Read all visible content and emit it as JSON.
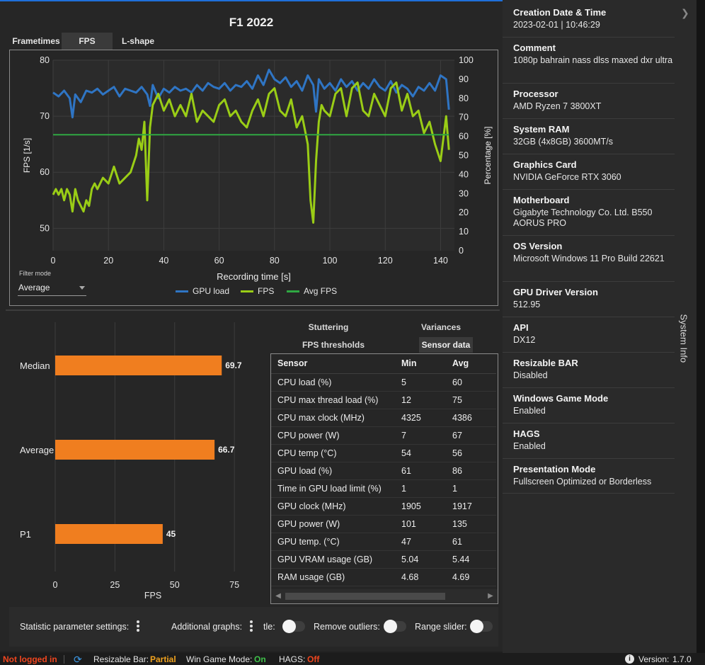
{
  "title": "F1 2022",
  "tabs": [
    "Frametimes",
    "FPS",
    "L-shape"
  ],
  "active_tab": "FPS",
  "filter": {
    "label": "Filter mode",
    "value": "Average"
  },
  "legend": [
    {
      "label": "GPU load",
      "color": "#2f75c4"
    },
    {
      "label": "FPS",
      "color": "#9acd16"
    },
    {
      "label": "Avg FPS",
      "color": "#2fa842"
    }
  ],
  "chart_data": [
    {
      "type": "line",
      "xlabel": "Recording time [s]",
      "ylabel": "FPS [1/s]",
      "y2label": "Percentage [%]",
      "xlim": [
        0,
        145
      ],
      "ylim": [
        46,
        80
      ],
      "y2lim": [
        0,
        100
      ],
      "xticks": [
        0,
        20,
        40,
        60,
        80,
        100,
        120,
        140
      ],
      "yticks": [
        50,
        60,
        70,
        80
      ],
      "y2ticks": [
        0,
        10,
        20,
        30,
        40,
        50,
        60,
        70,
        80,
        90,
        100
      ],
      "grid": true,
      "legend_position": "bottom",
      "series": [
        {
          "name": "GPU load",
          "axis": "right",
          "color": "#2f75c4",
          "x": [
            0,
            2,
            4,
            6,
            7,
            8,
            10,
            12,
            14,
            16,
            18,
            20,
            22,
            24,
            26,
            28,
            30,
            32,
            34,
            35,
            36,
            38,
            40,
            42,
            44,
            46,
            48,
            50,
            52,
            54,
            56,
            58,
            60,
            62,
            64,
            66,
            68,
            70,
            72,
            74,
            76,
            78,
            80,
            82,
            84,
            86,
            88,
            90,
            92,
            94,
            95,
            96,
            98,
            100,
            102,
            104,
            106,
            108,
            110,
            112,
            114,
            116,
            118,
            120,
            122,
            124,
            126,
            128,
            130,
            132,
            134,
            136,
            138,
            140,
            142,
            143
          ],
          "y": [
            83,
            81,
            84,
            80,
            70,
            82,
            78,
            84,
            83,
            85,
            82,
            84,
            86,
            81,
            85,
            84,
            83,
            86,
            82,
            76,
            87,
            80,
            85,
            83,
            86,
            84,
            85,
            83,
            87,
            84,
            88,
            86,
            85,
            88,
            84,
            87,
            86,
            89,
            85,
            92,
            87,
            95,
            90,
            88,
            91,
            86,
            89,
            84,
            92,
            87,
            73,
            90,
            85,
            88,
            84,
            90,
            86,
            89,
            84,
            88,
            85,
            90,
            86,
            84,
            89,
            83,
            87,
            85,
            81,
            86,
            84,
            88,
            84,
            92,
            90,
            74
          ]
        },
        {
          "name": "FPS",
          "axis": "left",
          "color": "#9acd16",
          "x": [
            0,
            1,
            2,
            3,
            4,
            5,
            6,
            7,
            8,
            9,
            10,
            11,
            12,
            13,
            14,
            15,
            16,
            18,
            20,
            22,
            24,
            26,
            28,
            30,
            31,
            32,
            33,
            34,
            35,
            36,
            38,
            40,
            42,
            44,
            46,
            48,
            50,
            52,
            54,
            56,
            58,
            60,
            62,
            64,
            66,
            68,
            70,
            72,
            74,
            76,
            78,
            80,
            82,
            84,
            86,
            88,
            90,
            92,
            93,
            94,
            95,
            96,
            97,
            98,
            100,
            102,
            104,
            106,
            108,
            110,
            112,
            114,
            116,
            118,
            120,
            122,
            124,
            126,
            128,
            130,
            132,
            134,
            136,
            138,
            140,
            142,
            143
          ],
          "y": [
            56,
            57,
            56,
            57,
            55,
            57,
            56,
            53,
            57,
            55,
            54,
            53,
            55,
            54,
            57,
            58,
            57,
            59,
            58,
            61,
            58,
            59,
            60,
            63,
            66,
            64,
            69,
            55,
            68,
            72,
            74,
            71,
            73,
            70,
            72,
            70,
            74,
            69,
            71,
            70,
            69,
            72,
            73,
            70,
            71,
            69,
            68,
            71,
            73,
            70,
            74,
            75,
            71,
            70,
            73,
            68,
            70,
            65,
            55,
            51,
            62,
            69,
            72,
            71,
            70,
            74,
            75,
            70,
            75,
            76,
            71,
            70,
            74,
            72,
            70,
            75,
            76,
            71,
            74,
            70,
            71,
            67,
            69,
            65,
            62,
            70,
            64
          ]
        },
        {
          "name": "Avg FPS",
          "axis": "left",
          "color": "#2fa842",
          "x": [
            0,
            143
          ],
          "y": [
            66.7,
            66.7
          ]
        }
      ]
    },
    {
      "type": "bar",
      "orientation": "horizontal",
      "xlabel": "FPS",
      "categories": [
        "Median",
        "Average",
        "P1"
      ],
      "values": [
        69.7,
        66.7,
        45
      ],
      "xlim": [
        0,
        80
      ],
      "xticks": [
        0,
        25,
        50,
        75
      ],
      "color": "#f07e1f",
      "grid": true
    }
  ],
  "sensor_tabs": [
    {
      "label": "Stuttering"
    },
    {
      "label": "Variances"
    },
    {
      "label": "FPS thresholds"
    },
    {
      "label": "Sensor data"
    }
  ],
  "sensor_table": {
    "columns": [
      "Sensor",
      "Min",
      "Avg"
    ],
    "rows": [
      [
        "CPU load (%)",
        "5",
        "60"
      ],
      [
        "CPU max thread load (%)",
        "12",
        "75"
      ],
      [
        "CPU max clock (MHz)",
        "4325",
        "4386"
      ],
      [
        "CPU power (W)",
        "7",
        "67"
      ],
      [
        "CPU temp (°C)",
        "54",
        "56"
      ],
      [
        "GPU load (%)",
        "61",
        "86"
      ],
      [
        "Time in GPU load limit (%)",
        "1",
        "1"
      ],
      [
        "GPU clock (MHz)",
        "1905",
        "1917"
      ],
      [
        "GPU power (W)",
        "101",
        "135"
      ],
      [
        "GPU temp. (°C)",
        "47",
        "61"
      ],
      [
        "GPU VRAM usage (GB)",
        "5.04",
        "5.44"
      ],
      [
        "RAM usage (GB)",
        "4.68",
        "4.69"
      ]
    ]
  },
  "settings": {
    "statistic_label": "Statistic parameter settings:",
    "additional_label": "Additional graphs:",
    "cut_label": "tle:",
    "outliers_label": "Remove outliers:",
    "range_label": "Range slider:"
  },
  "system_info": {
    "panel_label": "System Info",
    "items": [
      {
        "key": "Creation Date & Time",
        "value": "2023-02-01  |  10:46:29"
      },
      {
        "key": "Comment",
        "value": "1080p bahrain nass dlss maxed dxr ultra"
      },
      {
        "key": "Processor",
        "value": "AMD Ryzen 7 3800XT"
      },
      {
        "key": "System RAM",
        "value": "32GB (4x8GB) 3600MT/s"
      },
      {
        "key": "Graphics Card",
        "value": "NVIDIA GeForce RTX 3060"
      },
      {
        "key": "Motherboard",
        "value": "Gigabyte Technology Co. Ltd. B550 AORUS PRO"
      },
      {
        "key": "OS Version",
        "value": "Microsoft Windows 11 Pro Build 22621"
      },
      {
        "key": "GPU Driver Version",
        "value": "512.95"
      },
      {
        "key": "API",
        "value": "DX12"
      },
      {
        "key": "Resizable BAR",
        "value": "Disabled"
      },
      {
        "key": "Windows Game Mode",
        "value": "Enabled"
      },
      {
        "key": "HAGS",
        "value": "Enabled"
      },
      {
        "key": "Presentation Mode",
        "value": "Fullscreen Optimized or Borderless"
      }
    ]
  },
  "status": {
    "login": "Not logged in",
    "resizable_bar_label": "Resizable Bar:",
    "resizable_bar_value": "Partial",
    "game_mode_label": "Win Game Mode:",
    "game_mode_value": "On",
    "hags_label": "HAGS:",
    "hags_value": "Off",
    "version_label": "Version:",
    "version_value": "1.7.0"
  }
}
